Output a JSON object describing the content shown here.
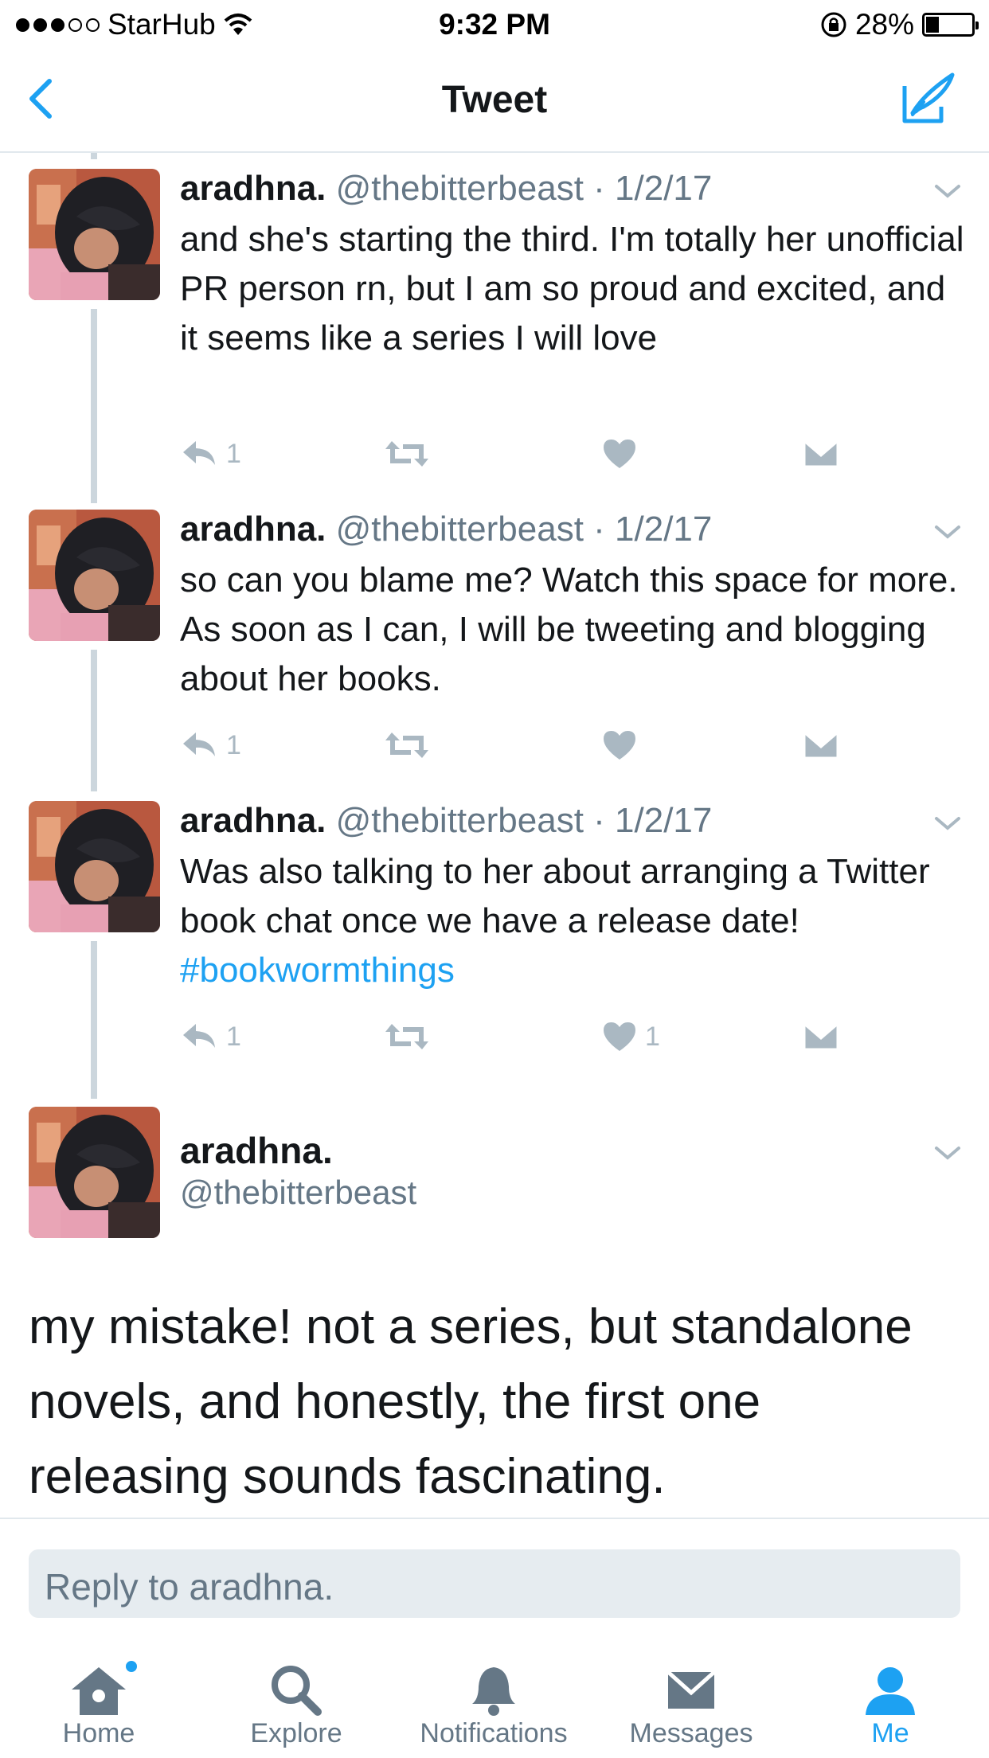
{
  "status_bar": {
    "carrier": "StarHub",
    "time": "9:32 PM",
    "battery": "28%",
    "battery_level": 0.28
  },
  "nav": {
    "title": "Tweet"
  },
  "thread": [
    {
      "name": "aradhna.",
      "handle": "@thebitterbeast",
      "date": "· 1/2/17",
      "text": "and she's starting the third. I'm totally her unofficial PR person rn, but I am so proud and excited, and it seems like a series I will love",
      "hashtag": "",
      "reply_count": "1",
      "like_count": ""
    },
    {
      "name": "aradhna.",
      "handle": "@thebitterbeast",
      "date": "· 1/2/17",
      "text": "so can you blame me? Watch this space for more. As soon as I can, I will be tweeting and blogging about her books.",
      "hashtag": "",
      "reply_count": "1",
      "like_count": ""
    },
    {
      "name": "aradhna.",
      "handle": "@thebitterbeast",
      "date": "· 1/2/17",
      "text": "Was also talking to her about arranging a Twitter book chat once we have a release date! ",
      "hashtag": "#bookwormthings",
      "reply_count": "1",
      "like_count": "1"
    }
  ],
  "main_tweet": {
    "name": "aradhna.",
    "handle": "@thebitterbeast",
    "text": "my mistake! not a series, but standalone novels, and honestly, the first one releasing sounds fascinating."
  },
  "reply_bar": {
    "placeholder": "Reply to aradhna."
  },
  "tabbar": {
    "home": "Home",
    "explore": "Explore",
    "notifications": "Notifications",
    "messages": "Messages",
    "me": "Me"
  },
  "colors": {
    "accent": "#1da1f2",
    "icon_gray": "#aab8c2",
    "text_secondary": "#657786"
  }
}
